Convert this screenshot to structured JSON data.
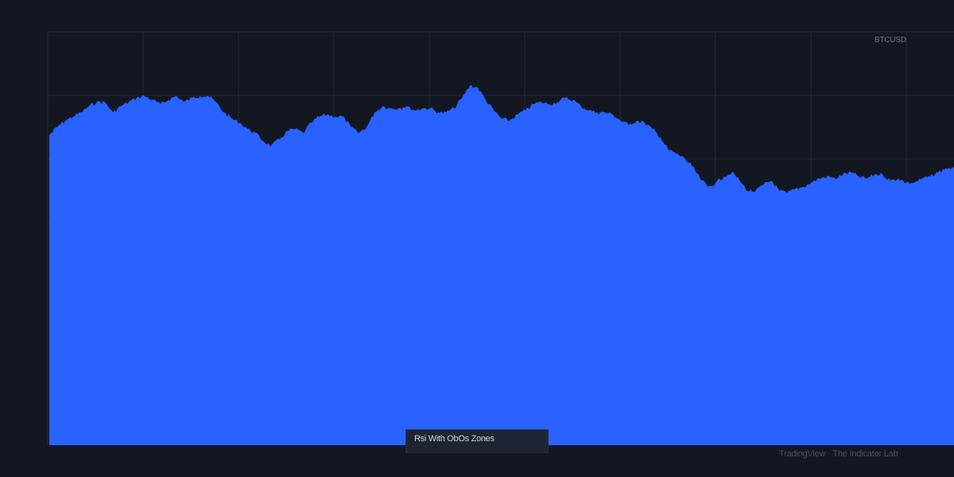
{
  "symbol_label": "BTCUSD",
  "indicator_label": "Rsi With ObOs Zones",
  "watermark": "TradingView · The Indicator Lab",
  "colors": {
    "background": "#131722",
    "grid": "#252a36",
    "area_fill": "#2962ff"
  },
  "chart_data": {
    "type": "area",
    "title": "",
    "xlabel": "",
    "ylabel": "",
    "grid": true,
    "ylim": [
      0,
      100
    ],
    "x": [
      0,
      10,
      20,
      30,
      40,
      50,
      60,
      70,
      80,
      90,
      100,
      110,
      120,
      130,
      140,
      150,
      160,
      170,
      180,
      190,
      200,
      210,
      220,
      230,
      240,
      250,
      260,
      270,
      280,
      290,
      300,
      310,
      320,
      330,
      340,
      350,
      360,
      370,
      380,
      390,
      400,
      410,
      420,
      430,
      440,
      450,
      460,
      470,
      480,
      490,
      500,
      510,
      520,
      530,
      540,
      550,
      560,
      570,
      580,
      590,
      600,
      610,
      620,
      630,
      640,
      650,
      660,
      670,
      680,
      690,
      700,
      710,
      720,
      730,
      740,
      750,
      760,
      770,
      780,
      790,
      800,
      810,
      820,
      830,
      840,
      850,
      860,
      870,
      880,
      890,
      900,
      910,
      920,
      930,
      940,
      950,
      960,
      970,
      980,
      990,
      1000,
      1010,
      1020,
      1030,
      1040,
      1050,
      1060,
      1070,
      1080,
      1090,
      1100,
      1110,
      1120,
      1130,
      1140
    ],
    "series": [
      {
        "values": [
          75,
          77,
          78.5,
          79.5,
          80.5,
          82,
          83,
          83,
          80.5,
          82,
          83,
          84,
          84.5,
          83.5,
          82.5,
          83.5,
          84.5,
          83,
          84,
          84.5,
          84.5,
          83,
          80.5,
          79,
          78,
          76.5,
          75.5,
          73.5,
          72.5,
          74,
          76,
          76.5,
          75.5,
          78,
          79.5,
          80,
          79.5,
          79.5,
          77,
          75.5,
          77,
          80.5,
          82,
          81.5,
          81.5,
          82,
          81,
          81.5,
          81.5,
          80.5,
          80.5,
          81.5,
          84,
          87,
          86.5,
          83.5,
          81,
          79,
          78.5,
          80,
          81,
          82.5,
          83,
          82.5,
          83,
          84,
          83.5,
          82,
          81,
          80.5,
          80.5,
          80,
          78.5,
          77.5,
          78.5,
          78,
          76.5,
          74.5,
          71.5,
          70.5,
          69.5,
          67.5,
          64.5,
          62.5,
          63.5,
          65,
          66,
          64,
          61.5,
          61.5,
          63,
          64,
          61.5,
          61,
          62,
          62.5,
          63.5,
          64.5,
          65,
          64.5,
          65.5,
          66,
          65,
          64.5,
          65.5,
          65.5,
          64,
          64.5,
          63.5,
          63.5,
          64.5,
          65,
          66,
          67,
          67
        ]
      }
    ]
  }
}
